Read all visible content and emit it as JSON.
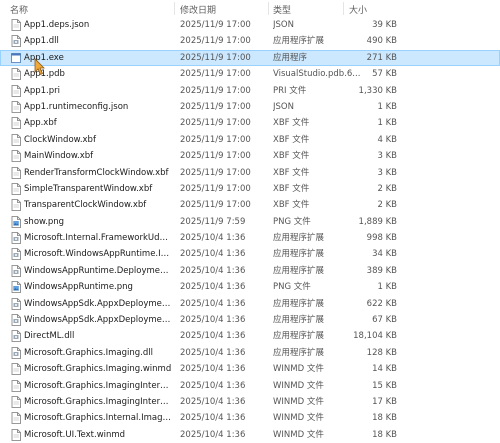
{
  "header": {
    "name": "名称",
    "date": "修改日期",
    "type": "类型",
    "size": "大小"
  },
  "files": [
    {
      "name": "App1.deps.json",
      "date": "2025/11/9 17:00",
      "type": "JSON",
      "size": "39 KB",
      "icon": "file-icon"
    },
    {
      "name": "App1.dll",
      "date": "2025/11/9 17:00",
      "type": "应用程序扩展",
      "size": "490 KB",
      "icon": "dll-icon"
    },
    {
      "name": "App1.exe",
      "date": "2025/11/9 17:00",
      "type": "应用程序",
      "size": "271 KB",
      "icon": "exe-icon",
      "selected": true
    },
    {
      "name": "App1.pdb",
      "date": "2025/11/9 17:00",
      "type": "VisualStudio.pdb.6...",
      "size": "57 KB",
      "icon": "file-icon"
    },
    {
      "name": "App1.pri",
      "date": "2025/11/9 17:00",
      "type": "PRI 文件",
      "size": "1,330 KB",
      "icon": "file-icon"
    },
    {
      "name": "App1.runtimeconfig.json",
      "date": "2025/11/9 17:00",
      "type": "JSON",
      "size": "1 KB",
      "icon": "file-icon"
    },
    {
      "name": "App.xbf",
      "date": "2025/11/9 17:00",
      "type": "XBF 文件",
      "size": "1 KB",
      "icon": "file-icon"
    },
    {
      "name": "ClockWindow.xbf",
      "date": "2025/11/9 17:00",
      "type": "XBF 文件",
      "size": "4 KB",
      "icon": "file-icon"
    },
    {
      "name": "MainWindow.xbf",
      "date": "2025/11/9 17:00",
      "type": "XBF 文件",
      "size": "3 KB",
      "icon": "file-icon"
    },
    {
      "name": "RenderTransformClockWindow.xbf",
      "date": "2025/11/9 17:00",
      "type": "XBF 文件",
      "size": "3 KB",
      "icon": "file-icon"
    },
    {
      "name": "SimpleTransparentWindow.xbf",
      "date": "2025/11/9 17:00",
      "type": "XBF 文件",
      "size": "2 KB",
      "icon": "file-icon"
    },
    {
      "name": "TransparentClockWindow.xbf",
      "date": "2025/11/9 17:00",
      "type": "XBF 文件",
      "size": "2 KB",
      "icon": "file-icon"
    },
    {
      "name": "show.png",
      "date": "2025/11/9 7:59",
      "type": "PNG 文件",
      "size": "1,889 KB",
      "icon": "image-icon"
    },
    {
      "name": "Microsoft.Internal.FrameworkUdk.dll",
      "date": "2025/10/4 1:36",
      "type": "应用程序扩展",
      "size": "998 KB",
      "icon": "dll-icon"
    },
    {
      "name": "Microsoft.WindowsAppRuntime.Insights.Re...",
      "date": "2025/10/4 1:36",
      "type": "应用程序扩展",
      "size": "34 KB",
      "icon": "dll-icon"
    },
    {
      "name": "WindowsAppRuntime.DeploymentExtensio...",
      "date": "2025/10/4 1:36",
      "type": "应用程序扩展",
      "size": "389 KB",
      "icon": "dll-icon"
    },
    {
      "name": "WindowsAppRuntime.png",
      "date": "2025/10/4 1:36",
      "type": "PNG 文件",
      "size": "1 KB",
      "icon": "image-icon"
    },
    {
      "name": "WindowsAppSdk.AppxDeploymentExtensio...",
      "date": "2025/10/4 1:36",
      "type": "应用程序扩展",
      "size": "622 KB",
      "icon": "dll-icon"
    },
    {
      "name": "WindowsAppSdk.AppxDeploymentExtensio...",
      "date": "2025/10/4 1:36",
      "type": "应用程序扩展",
      "size": "67 KB",
      "icon": "dll-icon"
    },
    {
      "name": "DirectML.dll",
      "date": "2025/10/4 1:36",
      "type": "应用程序扩展",
      "size": "18,104 KB",
      "icon": "dll-icon"
    },
    {
      "name": "Microsoft.Graphics.Imaging.dll",
      "date": "2025/10/4 1:36",
      "type": "应用程序扩展",
      "size": "128 KB",
      "icon": "dll-icon"
    },
    {
      "name": "Microsoft.Graphics.Imaging.winmd",
      "date": "2025/10/4 1:36",
      "type": "WINMD 文件",
      "size": "14 KB",
      "icon": "file-icon"
    },
    {
      "name": "Microsoft.Graphics.ImagingInternal.ImageO...",
      "date": "2025/10/4 1:36",
      "type": "WINMD 文件",
      "size": "15 KB",
      "icon": "file-icon"
    },
    {
      "name": "Microsoft.Graphics.ImagingInternal.winmd",
      "date": "2025/10/4 1:36",
      "type": "WINMD 文件",
      "size": "17 KB",
      "icon": "file-icon"
    },
    {
      "name": "Microsoft.Graphics.Internal.Imaging.winmd",
      "date": "2025/10/4 1:36",
      "type": "WINMD 文件",
      "size": "18 KB",
      "icon": "file-icon"
    },
    {
      "name": "Microsoft.UI.Text.winmd",
      "date": "2025/10/4 1:36",
      "type": "WINMD 文件",
      "size": "18 KB",
      "icon": "file-icon"
    }
  ],
  "colors": {
    "selection": "#cce8ff",
    "selection_border": "#99d1ff",
    "cursor": "#f2a93b"
  }
}
